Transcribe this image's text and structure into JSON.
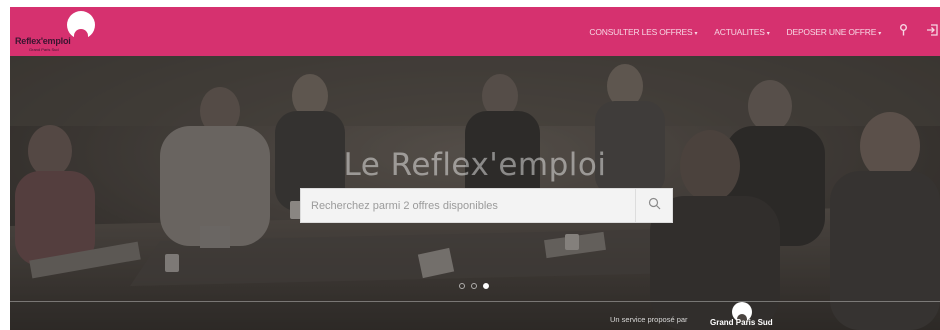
{
  "header": {
    "logo_text": "Reflex'emploi",
    "logo_sub": "Grand Paris Sud",
    "nav": [
      {
        "label": "CONSULTER LES OFFRES",
        "caret": "▾"
      },
      {
        "label": "ACTUALITES",
        "caret": "▾"
      },
      {
        "label": "DEPOSER UNE OFFRE",
        "caret": "▾"
      }
    ],
    "icons": [
      "map-pin-icon",
      "sign-in-icon"
    ]
  },
  "hero": {
    "title": "Le Reflex'emploi",
    "search_placeholder": "Recherchez parmi 2 offres disponibles",
    "slides": [
      {
        "active": false
      },
      {
        "active": false
      },
      {
        "active": true
      }
    ]
  },
  "footer": {
    "service_text": "Un service proposé par",
    "partner_logo_text": "Grand Paris Sud"
  },
  "colors": {
    "brand": "#d6316f",
    "hero_overlay": "#3f3a36"
  }
}
